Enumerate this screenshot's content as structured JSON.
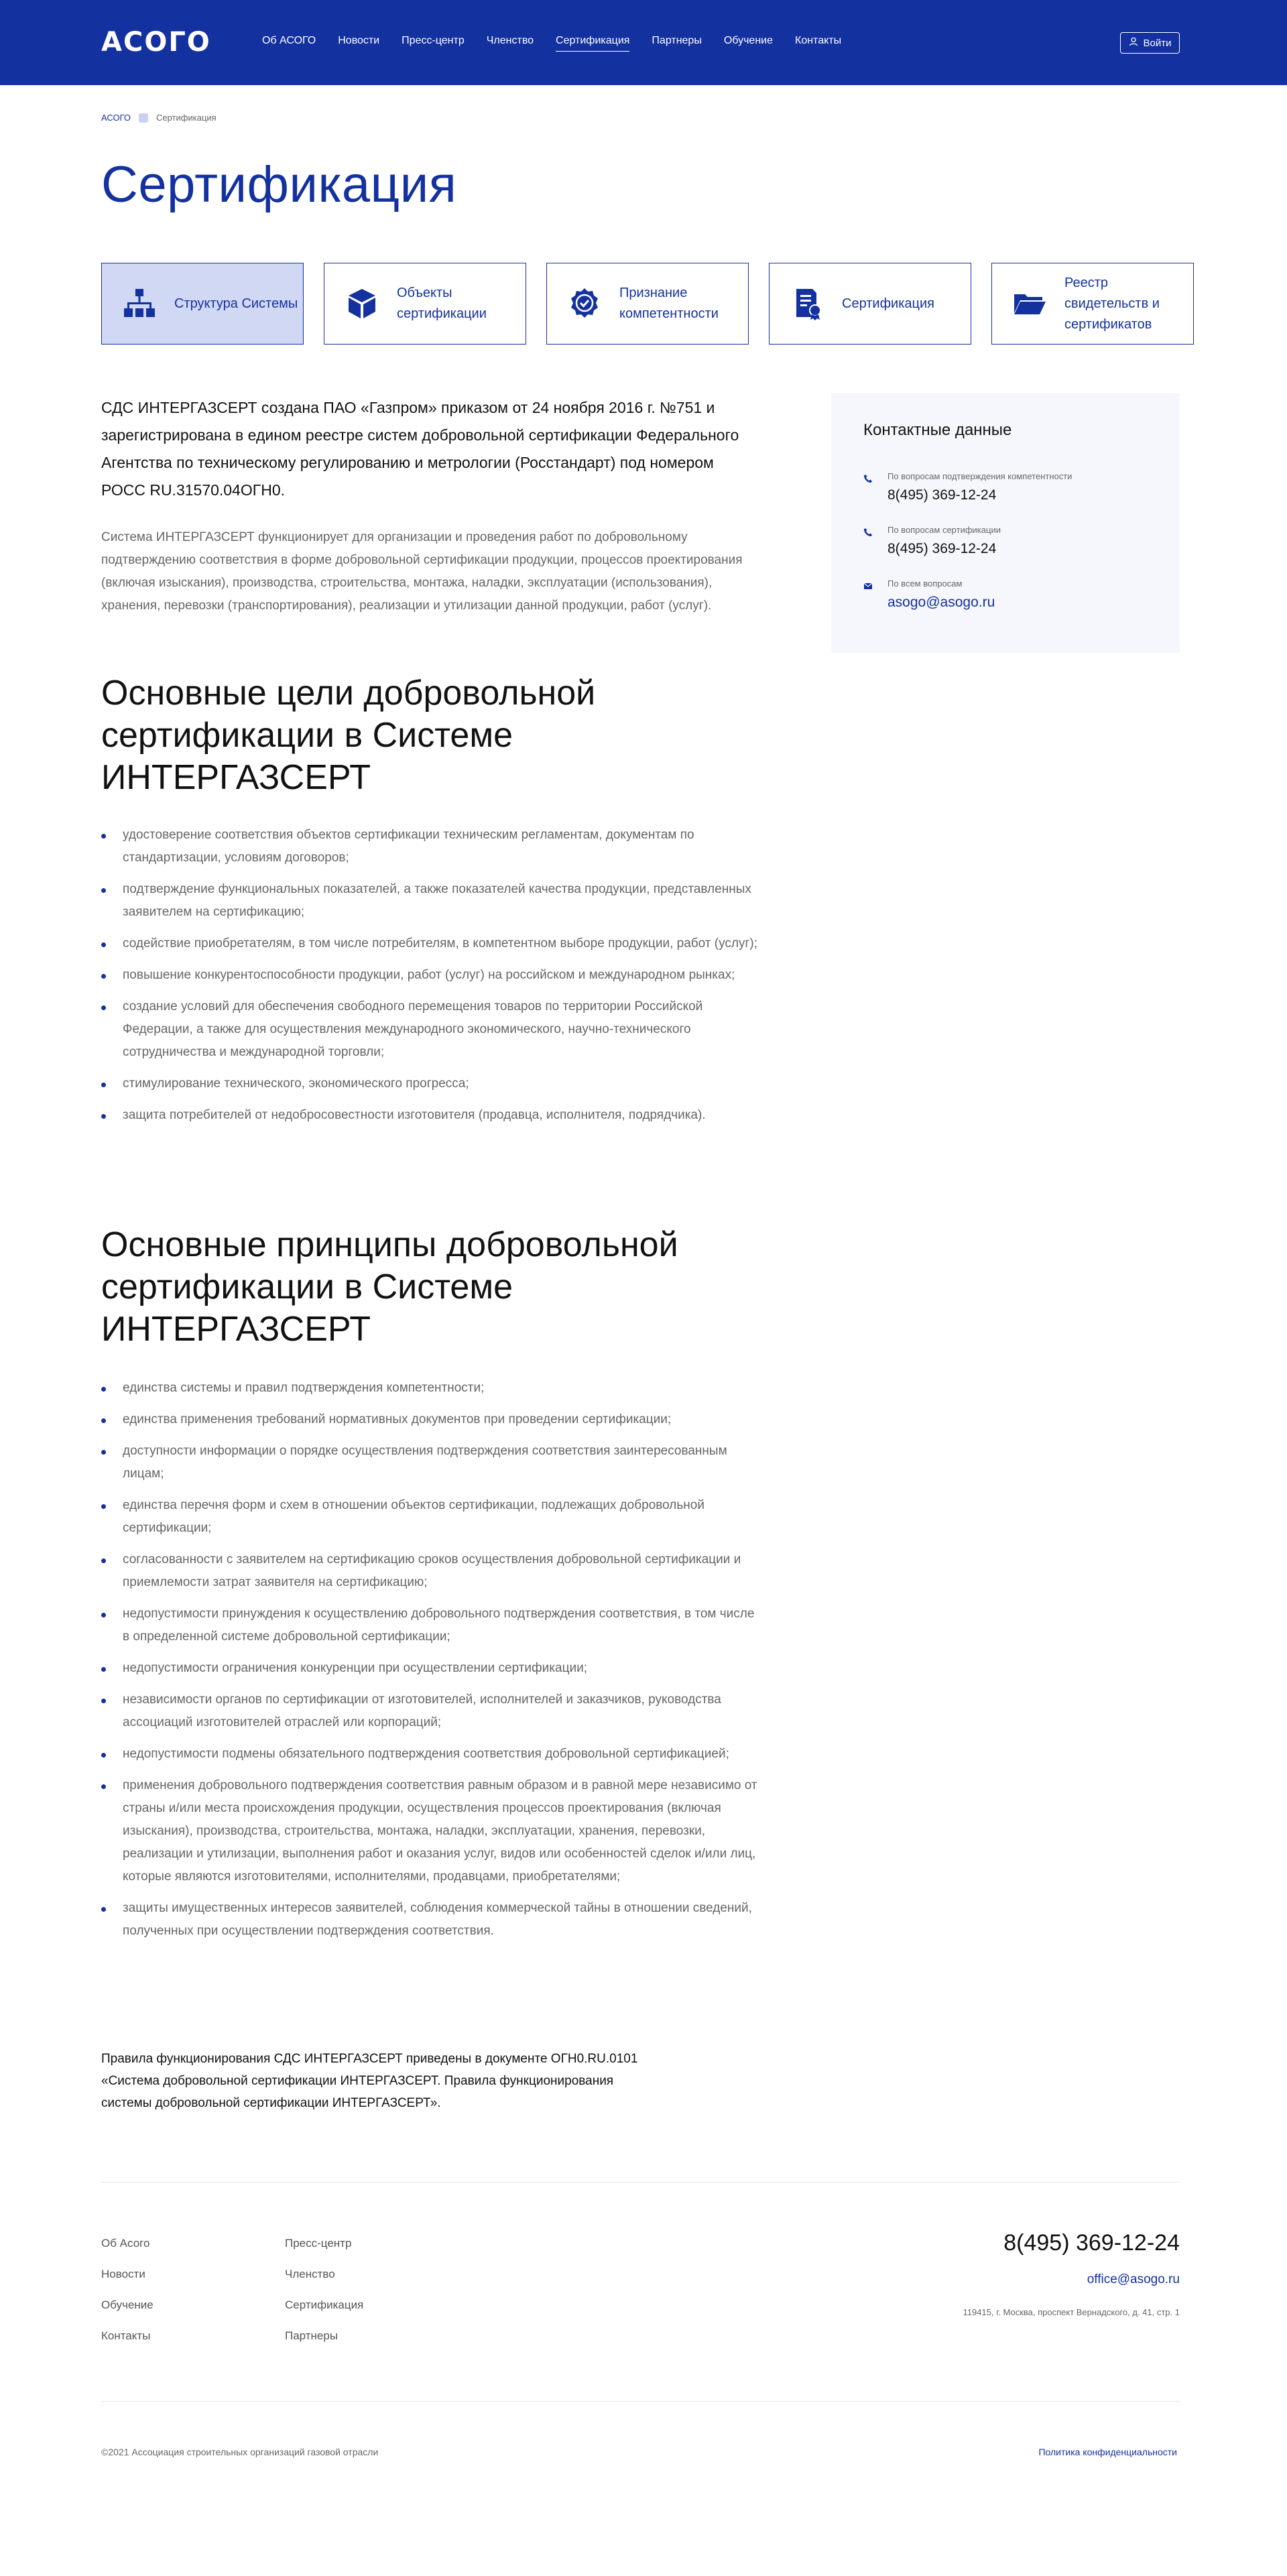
{
  "header": {
    "logo": "АСОГО",
    "nav": [
      "Об АСОГО",
      "Новости",
      "Пресс-центр",
      "Членство",
      "Сертификация",
      "Партнеры",
      "Обучение",
      "Контакты"
    ],
    "active_nav": "Сертификация",
    "login_label": "Войти"
  },
  "breadcrumb": {
    "home": "АСОГО",
    "current": "Сертификация"
  },
  "page_title": "Сертификация",
  "cards": [
    {
      "label": "Структура Системы",
      "icon": "structure-icon",
      "active": true
    },
    {
      "label": "Объекты сертификации",
      "icon": "cube-icon",
      "active": false
    },
    {
      "label": "Признание компетентности",
      "icon": "badge-check-icon",
      "active": false
    },
    {
      "label": "Сертификация",
      "icon": "certificate-icon",
      "active": false
    },
    {
      "label": "Реестр свидетельств и сертификатов",
      "icon": "folder-icon",
      "active": false
    }
  ],
  "main": {
    "lead": "СДС ИНТЕРГАЗСЕРТ создана ПАО «Газпром» приказом от 24 ноября 2016 г. №751 и зарегистрирована в едином реестре систем добровольной сертификации Федерального Агентства по техническому регулированию и метрологии (Росстандарт) под номером РОСС RU.31570.04ОГН0.",
    "intro": "Система ИНТЕРГАЗСЕРТ функционирует для организации и проведения работ по добровольному подтверждению соответствия в форме добровольной сертификации продукции, процессов проектирования (включая изыскания), производства, строительства, монтажа, наладки, эксплуатации (использования), хранения, перевозки (транспортирования), реализации и утилизации данной продукции, работ (услуг).",
    "goals_title": "Основные цели добровольной сертификации в Системе ИНТЕРГАЗСЕРТ",
    "goals": [
      "удостоверение соответствия объектов сертификации техническим регламентам, документам по стандартизации, условиям договоров;",
      "подтверждение функциональных показателей, а также показателей качества продукции, представленных заявителем на сертификацию;",
      "содействие приобретателям, в том числе потребителям, в компетентном выборе продукции, работ (услуг);",
      "повышение конкурентоспособности продукции, работ (услуг) на российском и международном рынках;",
      "создание условий для обеспечения свободного перемещения товаров по территории Российской Федерации, а также для осуществления международного экономического, научно-технического сотрудничества и международной торговли;",
      "стимулирование технического, экономического прогресса;",
      "защита потребителей от недобросовестности изготовителя (продавца, исполнителя, подрядчика)."
    ],
    "principles_title": "Основные принципы добровольной сертификации в Системе ИНТЕРГАЗСЕРТ",
    "principles": [
      "единства системы и правил подтверждения компетентности;",
      "единства применения требований нормативных документов при проведении сертификации;",
      "доступности информации о порядке осуществления подтверждения соответствия заинтересованным лицам;",
      "единства перечня форм и схем в отношении объектов сертификации, подлежащих добровольной сертификации;",
      "согласованности с заявителем на сертификацию сроков осуществления добровольной сертификации и приемлемости затрат заявителя на сертификацию;",
      "недопустимости принуждения к осуществлению добровольного подтверждения соответствия, в том числе в определенной системе добровольной сертификации;",
      "недопустимости ограничения конкуренции при осуществлении сертификации;",
      "независимости органов по сертификации от изготовителей, исполнителей и заказчиков, руководства ассоциаций изготовителей отраслей или корпораций;",
      "недопустимости подмены обязательного подтверждения соответствия добровольной сертификацией;",
      "применения добровольного подтверждения соответствия равным образом и в равной мере независимо от страны и/или места происхождения продукции, осуществления процессов проектирования (включая изыскания), производства, строительства, монтажа, наладки, эксплуатации, хранения, перевозки, реализации и утилизации, выполнения работ и оказания услуг, видов или особенностей сделок и/или лиц, которые являются изготовителями, исполнителями, продавцами, приобретателями;",
      "защиты имущественных интересов заявителей, соблюдения коммерческой тайны в отношении сведений, полученных при осуществлении подтверждения соответствия."
    ],
    "rules": "Правила функционирования СДС ИНТЕРГАЗСЕРТ приведены в документе ОГН0.RU.0101 «Система добровольной сертификации ИНТЕРГАЗСЕРТ. Правила функционирования системы добровольной сертификации ИНТЕРГАЗСЕРТ»."
  },
  "contacts": {
    "title": "Контактные данные",
    "items": [
      {
        "label": "По вопросам подтверждения компетентности",
        "value": "8(495) 369-12-24",
        "icon": "phone-icon"
      },
      {
        "label": "По вопросам сертификации",
        "value": "8(495) 369-12-24",
        "icon": "phone-icon"
      },
      {
        "label": "По всем вопросам",
        "value": "asogo@asogo.ru",
        "icon": "mail-icon"
      }
    ]
  },
  "footer": {
    "col1": [
      "Об Асого",
      "Новости",
      "Обучение",
      "Контакты"
    ],
    "col2": [
      "Пресс-центр",
      "Членство",
      "Сертификация",
      "Партнеры"
    ],
    "phone": "8(495) 369-12-24",
    "email": "office@asogo.ru",
    "address": "119415, г. Москва, проспект Вернадского, д. 41, стр. 1",
    "copyright": "©2021 Ассоциация строительных организаций газовой отрасли",
    "privacy": "Политика конфиденциальности"
  },
  "colors": {
    "brand": "#13319f",
    "active_card": "#d1d8f4",
    "contacts_bg": "#f6f7fc"
  }
}
